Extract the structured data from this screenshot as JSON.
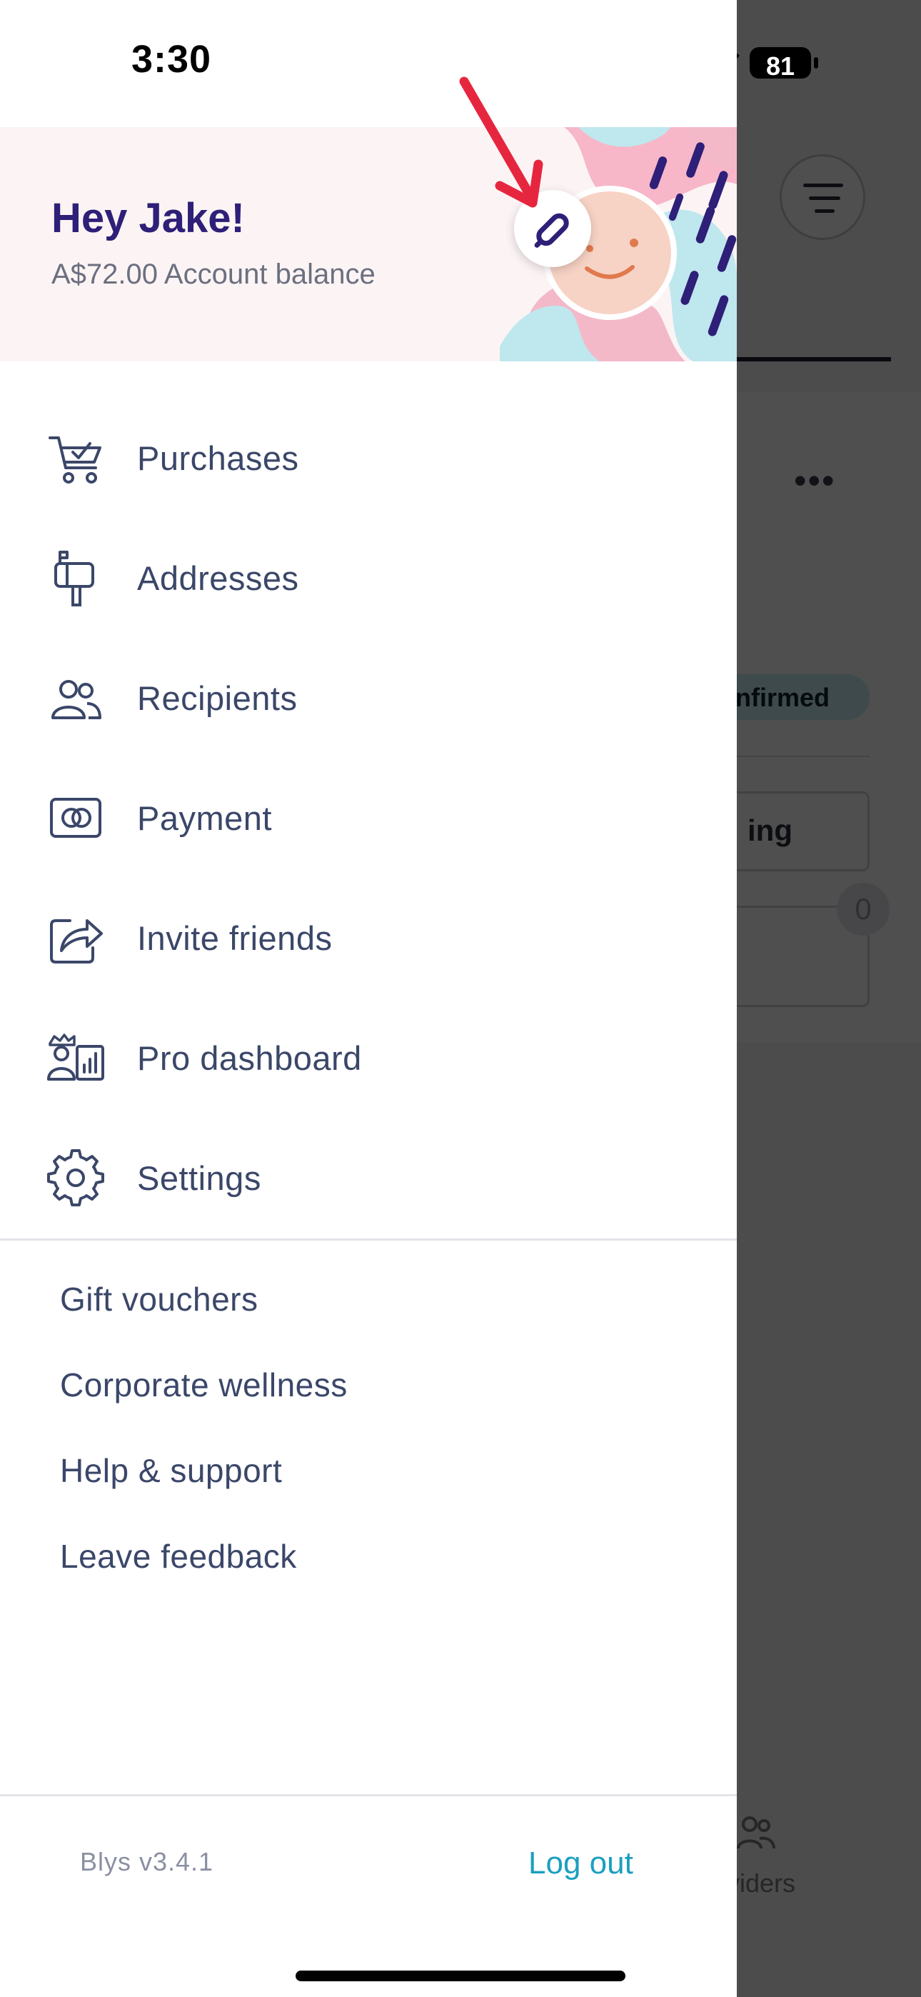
{
  "status_bar": {
    "time": "3:30",
    "battery": "81"
  },
  "drawer": {
    "header": {
      "greeting": "Hey Jake!",
      "balance": "A$72.00 Account balance"
    },
    "menu": [
      {
        "label": "Purchases",
        "icon": "cart-check-icon"
      },
      {
        "label": "Addresses",
        "icon": "mailbox-icon"
      },
      {
        "label": "Recipients",
        "icon": "users-icon"
      },
      {
        "label": "Payment",
        "icon": "card-icon"
      },
      {
        "label": "Invite friends",
        "icon": "share-icon"
      },
      {
        "label": "Pro dashboard",
        "icon": "pro-dashboard-icon"
      },
      {
        "label": "Settings",
        "icon": "gear-icon"
      }
    ],
    "links": [
      "Gift vouchers",
      "Corporate wellness",
      "Help & support",
      "Leave feedback"
    ],
    "footer": {
      "version": "Blys v3.4.1",
      "logout": "Log out"
    }
  },
  "background_app": {
    "tab_fragment": "ng",
    "badge_fragment": "nfirmed",
    "button_fragment": "ing",
    "count": "0",
    "tabbar_label_fragment": "viders"
  },
  "colors": {
    "greeting": "#2e1f78",
    "menu_text": "#3b4769",
    "logout": "#1a9fc1",
    "overlay": "#4d4d4f"
  }
}
